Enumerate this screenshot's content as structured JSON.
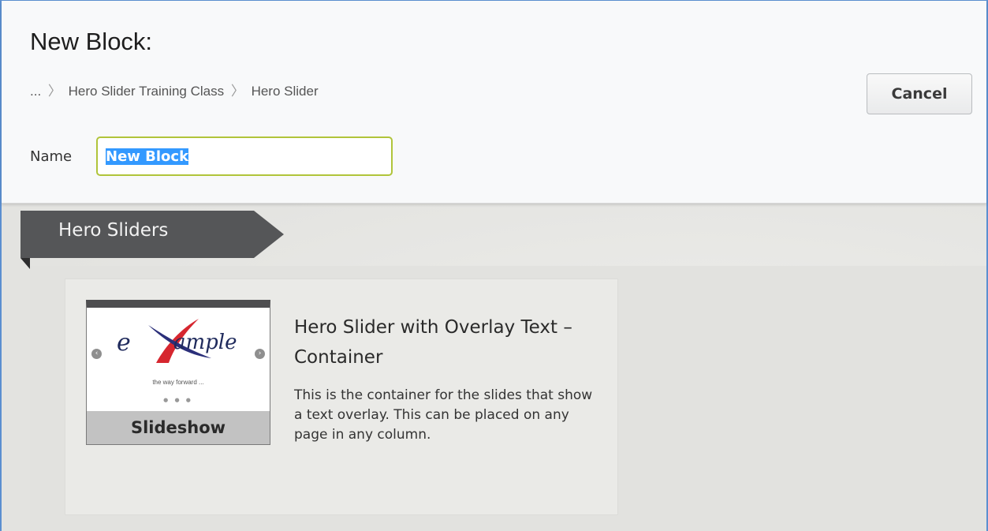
{
  "dialog": {
    "title": "New Block:",
    "breadcrumb": [
      "...",
      "Hero Slider Training Class",
      "Hero Slider"
    ],
    "cancel_label": "Cancel",
    "name_label": "Name",
    "name_value": "New Block"
  },
  "category": {
    "title": "Hero Sliders"
  },
  "templates": [
    {
      "title": "Hero Slider with Overlay Text – Container",
      "description": "This is the container for the slides that show a text overlay. This can be placed on any page in any column.",
      "thumbnail": {
        "logo_text": "example",
        "tagline": "the way forward ...",
        "footer_label": "Slideshow"
      }
    }
  ],
  "colors": {
    "input_focus_border": "#b0c43a",
    "ribbon": "#555658",
    "frame": "#5b8fd0"
  }
}
